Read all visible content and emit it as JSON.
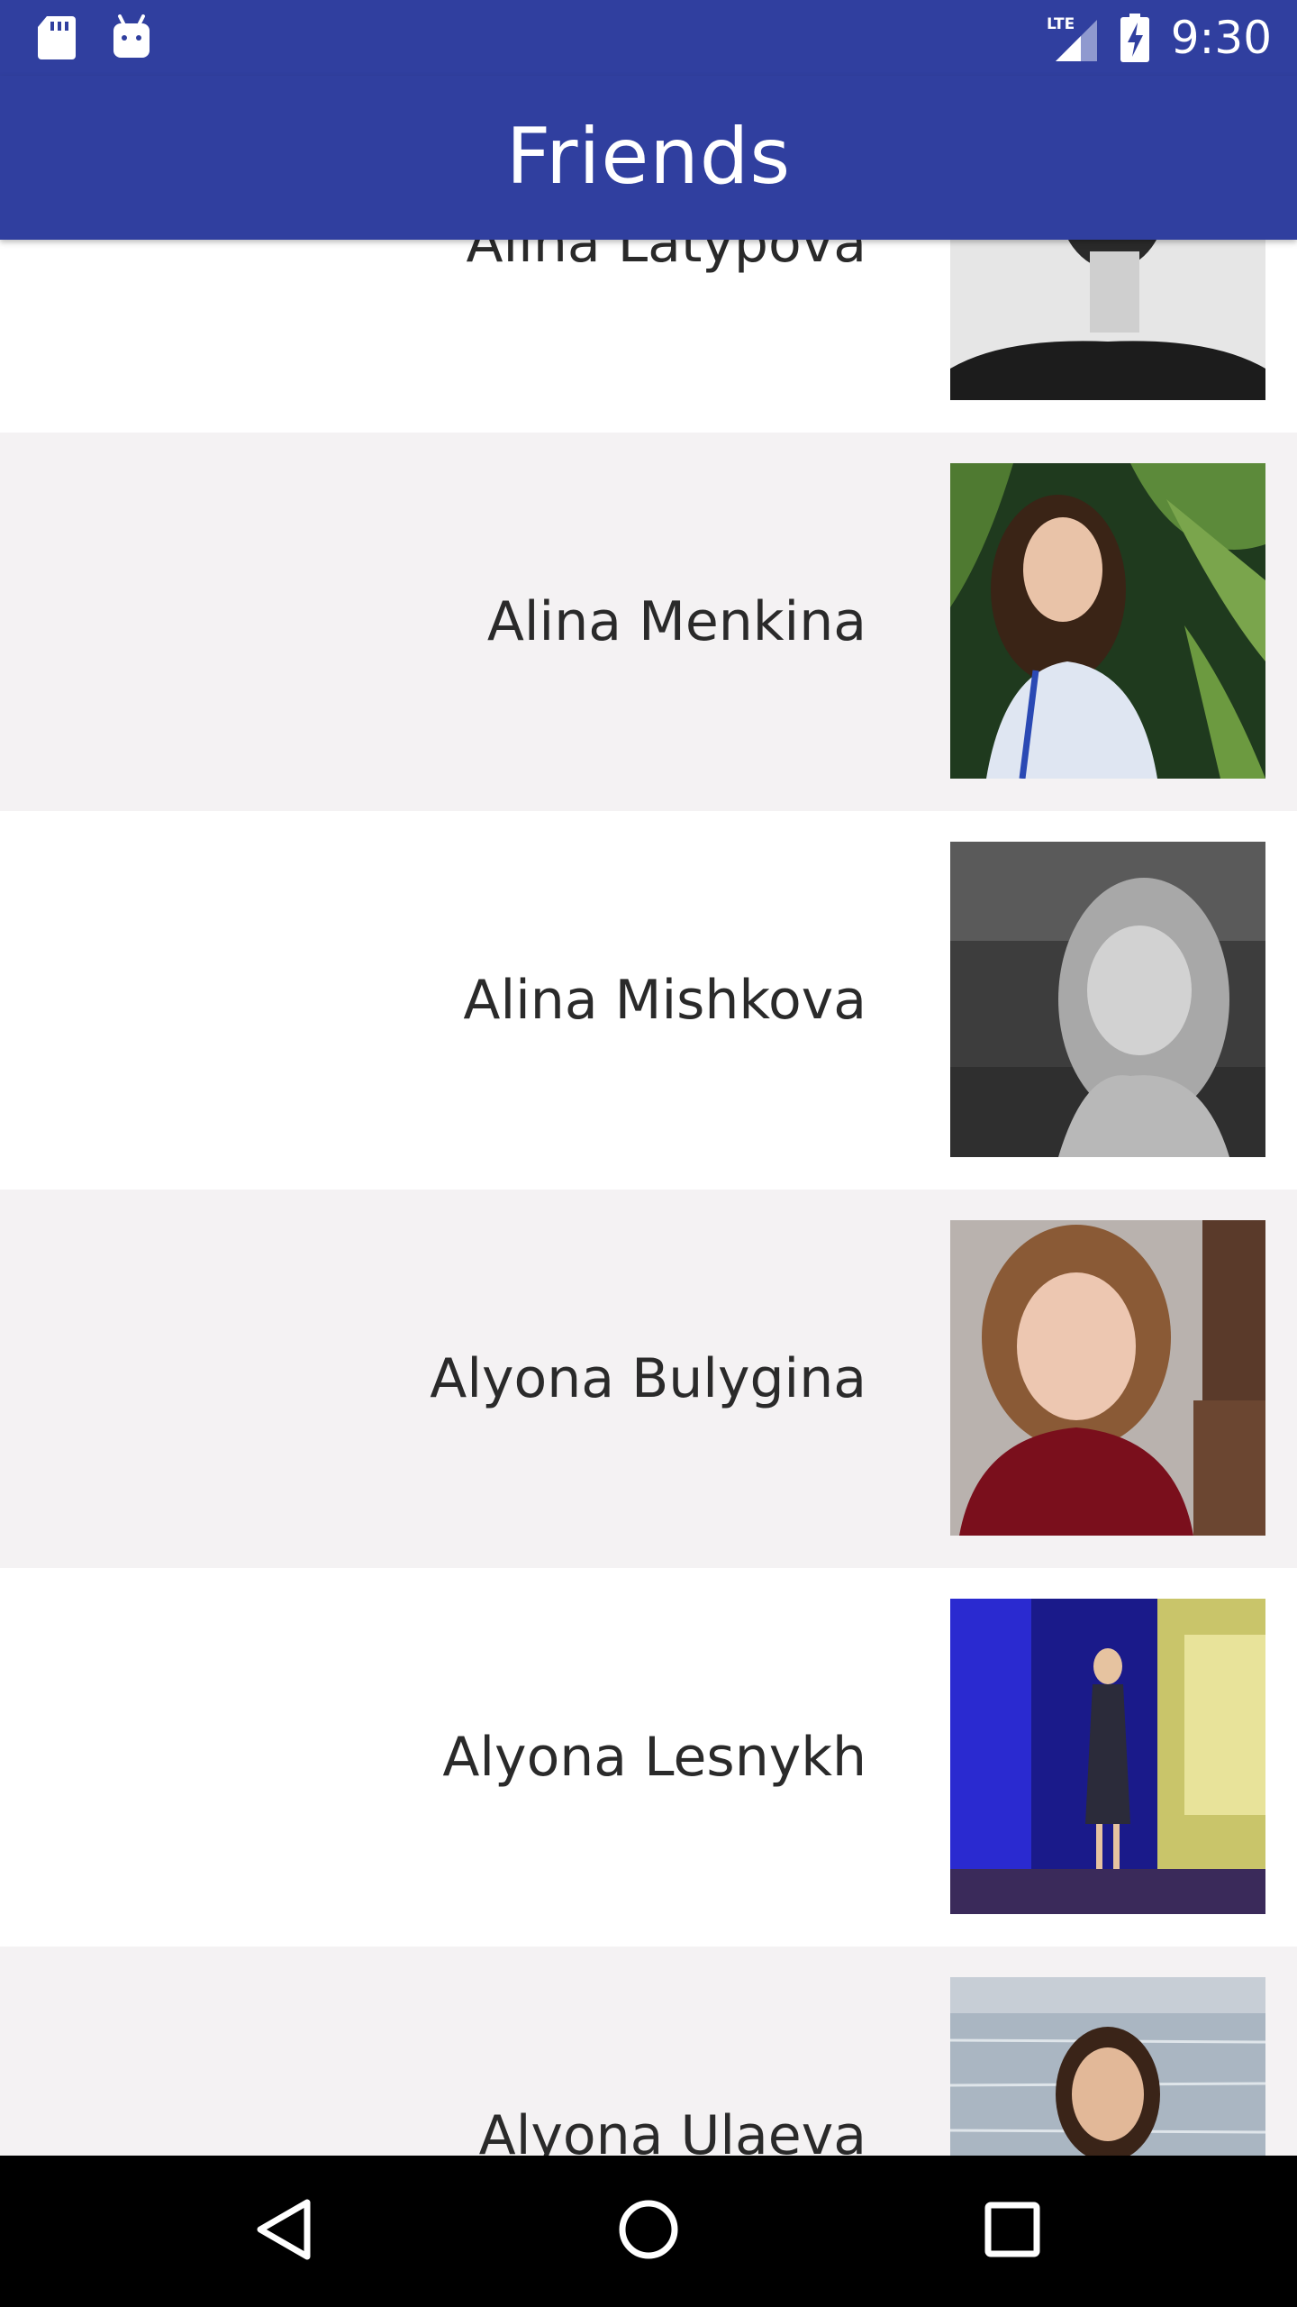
{
  "status_bar": {
    "time": "9:30",
    "network": "LTE",
    "icons": [
      "sd-card-icon",
      "android-icon",
      "lte-signal-icon",
      "battery-charging-icon"
    ]
  },
  "app_bar": {
    "title": "Friends",
    "color": "#303f9f"
  },
  "friends": [
    {
      "name": "Alina Latypova",
      "photo": "portrait-back-grayscale"
    },
    {
      "name": "Alina Menkina",
      "photo": "portrait-palm-leaves"
    },
    {
      "name": "Alina Mishkova",
      "photo": "portrait-grayscale-smiling"
    },
    {
      "name": "Alyona Bulygina",
      "photo": "portrait-red-sweater"
    },
    {
      "name": "Alyona Lesnykh",
      "photo": "portrait-on-stage"
    },
    {
      "name": "Alyona Ulaeva",
      "photo": "portrait-sea-background"
    }
  ],
  "navigation": {
    "back": "back-icon",
    "home": "home-icon",
    "recents": "recents-icon"
  }
}
